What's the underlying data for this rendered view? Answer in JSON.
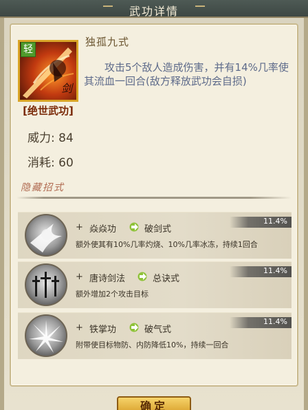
{
  "window": {
    "title": "武功详情"
  },
  "skill": {
    "name": "独孤九式",
    "badge": "轻",
    "icon_glyph": "剑",
    "rank": "[绝世武功]",
    "description": "攻击5个敌人造成伤害，并有14%几率使其流血一回合(敌方释放武功会自损)",
    "power_label": "威力:",
    "power_value": "84",
    "cost_label": "消耗:",
    "cost_value": "60"
  },
  "hidden_moves": {
    "title": "隐藏招式",
    "items": [
      {
        "plus": "+",
        "name": "焱焱功",
        "result": "破剑式",
        "rate": "11.4%",
        "desc": "额外使其有10%几率灼烧、10%几率冰冻，持续1回合",
        "icon": "burst-icon"
      },
      {
        "plus": "+",
        "name": "唐诗剑法",
        "result": "总诀式",
        "rate": "11.4%",
        "desc": "额外增加2个攻击目标",
        "icon": "swords-icon"
      },
      {
        "plus": "+",
        "name": "铁掌功",
        "result": "破气式",
        "rate": "11.4%",
        "desc": "附带使目标物防、内防降低10%，持续一回合",
        "icon": "palm-strike-icon"
      }
    ]
  },
  "footer": {
    "confirm_label": "确定"
  },
  "colors": {
    "accent": "#d59a24",
    "badge": "#4f9a2c",
    "rank": "#7a2a08"
  }
}
